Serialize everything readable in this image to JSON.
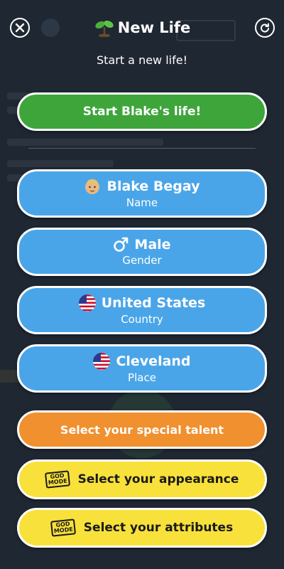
{
  "header": {
    "title": "New Life",
    "subtitle": "Start a new life!",
    "close_icon": "close-icon",
    "refresh_icon": "refresh-icon",
    "title_icon": "sprout-icon"
  },
  "start_button": {
    "label": "Start Blake's life!"
  },
  "options": [
    {
      "value": "Blake Begay",
      "label": "Name",
      "icon": "face-icon"
    },
    {
      "value": "Male",
      "label": "Gender",
      "icon": "male-symbol-icon"
    },
    {
      "value": "United States",
      "label": "Country",
      "icon": "us-flag-icon"
    },
    {
      "value": "Cleveland",
      "label": "Place",
      "icon": "us-flag-icon"
    }
  ],
  "talent_button": {
    "label": "Select your special talent"
  },
  "appearance_button": {
    "label": "Select your appearance",
    "badge_icon": "god-mode-icon"
  },
  "attributes_button": {
    "label": "Select your attributes",
    "badge_icon": "god-mode-icon"
  },
  "colors": {
    "green": "#3ea53b",
    "blue": "#4aa5e8",
    "orange": "#f0902f",
    "yellow": "#f8e13a",
    "background": "#26303c"
  }
}
